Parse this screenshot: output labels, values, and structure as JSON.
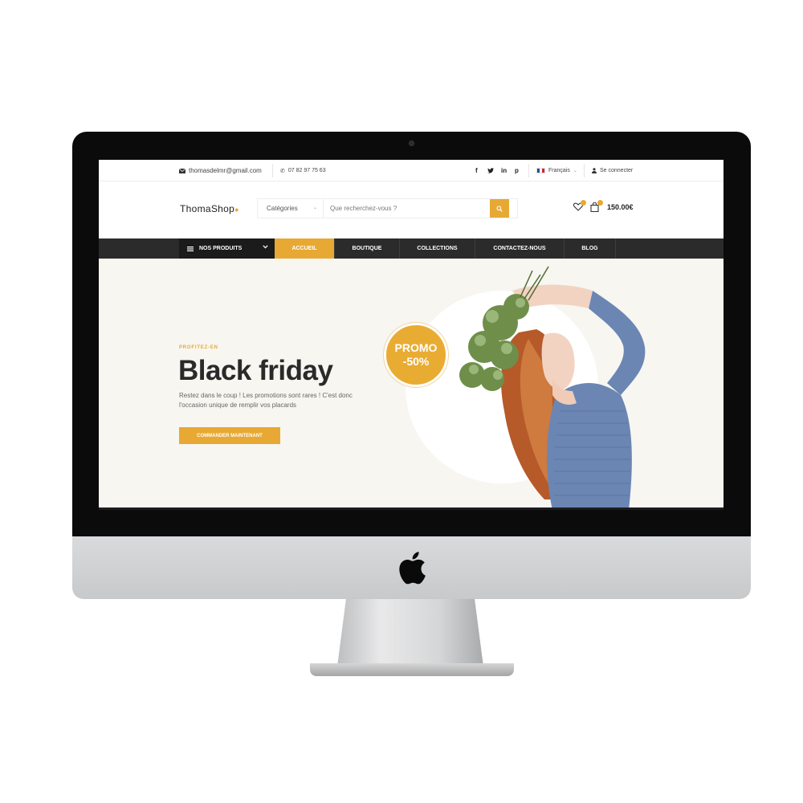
{
  "topbar": {
    "email": "thomasdelmr@gmail.com",
    "phone": "07 82 97 75 63",
    "social": {
      "facebook": "f",
      "twitter": "t",
      "linkedin": "in",
      "pinterest": "p"
    },
    "language": "Français",
    "login": "Se connecter"
  },
  "header": {
    "logo": "ThomaShop",
    "categories_label": "Catégories",
    "search_placeholder": "Que recherchez-vous ?",
    "cart_total": "150.00€"
  },
  "nav": {
    "products": "NOS PRODUITS",
    "tabs": [
      "ACCUEIL",
      "BOUTIQUE",
      "COLLECTIONS",
      "CONTACTEZ-NOUS",
      "BLOG"
    ],
    "active_tab": "ACCUEIL"
  },
  "hero": {
    "pre": "PROFITEZ-EN",
    "title": "Black friday",
    "desc": "Restez dans le coup ! Les promotions sont rares ! C'est donc l'occasion unique de remplir vos placards",
    "cta": "COMMANDER MAINTENANT",
    "promo_line1": "PROMO",
    "promo_line2": "-50%"
  },
  "colors": {
    "accent": "#e7a933",
    "nav_bg": "#2b2b2b",
    "hero_bg": "#f7f6f1"
  }
}
